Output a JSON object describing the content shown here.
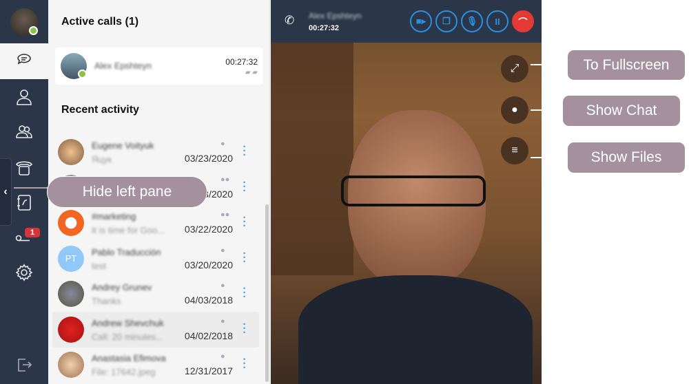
{
  "sidebar": {
    "items": [
      "chats",
      "contacts",
      "groups",
      "dialpad",
      "call-log",
      "voicemail",
      "settings",
      "logout"
    ],
    "voicemail_badge": "1",
    "collapse_label": "‹"
  },
  "pane": {
    "active_title": "Active calls (1)",
    "recent_title": "Recent activity",
    "active_call": {
      "name": "Alex Epshteyn",
      "duration": "00:27:32"
    },
    "recent": [
      {
        "name": "Eugene Voityuk",
        "message": "Яцук",
        "date": "03/23/2020",
        "type": "person"
      },
      {
        "name": "",
        "message": "",
        "date": "03/23/2020",
        "type": "group"
      },
      {
        "name": "#marketing",
        "message": "It is time for Goo...",
        "date": "03/22/2020",
        "type": "group"
      },
      {
        "name": "Pablo Traducción",
        "message": "test",
        "date": "03/20/2020",
        "type": "person",
        "initials": "PT"
      },
      {
        "name": "Andrey Grunev",
        "message": "Thanks",
        "date": "04/03/2018",
        "type": "person"
      },
      {
        "name": "Andrew Shevchuk",
        "message": "Call: 20 minutes...",
        "date": "04/02/2018",
        "type": "person"
      },
      {
        "name": "Anastasia Efimova",
        "message": "File: 17642.jpeg",
        "date": "12/31/2017",
        "type": "person"
      }
    ]
  },
  "call": {
    "name": "Alex Epshteyn",
    "duration": "00:27:32",
    "buttons": [
      "video",
      "screen-share",
      "mute",
      "hold",
      "hang-up"
    ]
  },
  "callouts": {
    "fullscreen": "To Fullscreen",
    "chat": "Show Chat",
    "files": "Show Files",
    "hide_pane": "Hide left pane"
  },
  "colors": {
    "sidebar": "#2c3649",
    "accent": "#2a90e0",
    "hangup": "#e53935",
    "callout": "#a4919d",
    "online": "#8bc34a"
  }
}
